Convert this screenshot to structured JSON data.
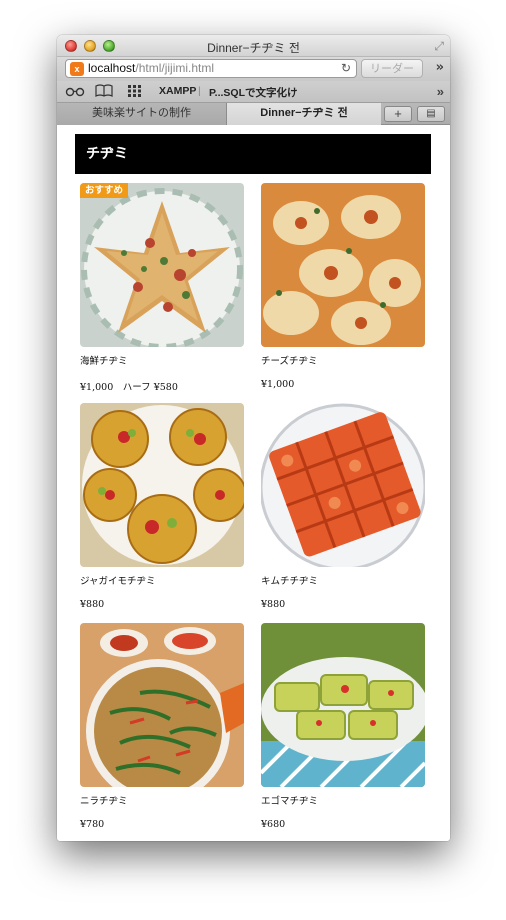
{
  "window": {
    "title": "Dinner−チヂミ 전"
  },
  "toolbar": {
    "url_host": "localhost",
    "url_path": "/html/jijimi.html",
    "favicon_label": "x",
    "reader_label": "リーダー"
  },
  "bookmarks": {
    "items": [
      "XAMPP",
      "P...SQLで文字化け"
    ]
  },
  "tabs": [
    {
      "label": "美味楽サイトの制作"
    },
    {
      "label": "Dinner−チヂミ 전"
    }
  ],
  "page": {
    "header_title": "チヂミ",
    "items": [
      {
        "name": "海鮮チヂミ",
        "price": "¥1,000　ハーフ ¥580",
        "badge": "おすすめ"
      },
      {
        "name": "チーズチヂミ",
        "price": "¥1,000"
      },
      {
        "name": "ジャガイモチヂミ",
        "price": "¥880"
      },
      {
        "name": "キムチチヂミ",
        "price": "¥880"
      },
      {
        "name": "ニラチヂミ",
        "price": "¥780"
      },
      {
        "name": "エゴマチヂミ",
        "price": "¥680"
      }
    ]
  },
  "colors": {
    "header_bg": "#000000",
    "badge_bg": "#f09a18"
  },
  "icons": [
    "close-light",
    "minimize-light",
    "zoom-light",
    "fullscreen-icon",
    "reload-icon",
    "reading-list-icon",
    "bookmarks-book-icon",
    "top-sites-grid-icon",
    "overflow-chevron-icon",
    "new-tab-plus-icon",
    "tab-view-icon"
  ]
}
